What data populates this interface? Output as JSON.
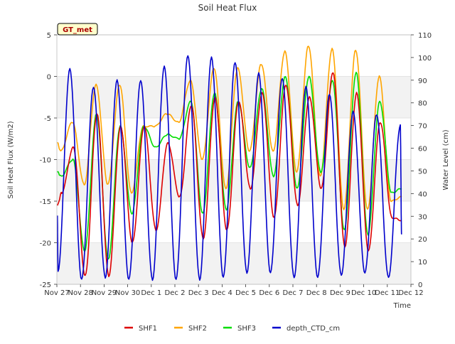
{
  "chart_data": {
    "type": "line",
    "title": "Soil Heat Flux",
    "xlabel": "Time",
    "ylabel": "Soil Heat Flux (W/m2)",
    "y2label": "Water Level (cm)",
    "site_badge": "GT_met",
    "x_ticks": [
      "Nov 27",
      "Nov 28",
      "Nov 29",
      "Nov 30",
      "Dec 1",
      "Dec 2",
      "Dec 3",
      "Dec 4",
      "Dec 5",
      "Dec 6",
      "Dec 7",
      "Dec 8",
      "Dec 9",
      "Dec 10",
      "Dec 11",
      "Dec 12"
    ],
    "x_start": "2023-11-27",
    "xlim_days": [
      0,
      15
    ],
    "ylim": [
      -25,
      5
    ],
    "y_ticks": [
      -25,
      -20,
      -15,
      -10,
      -5,
      0,
      5
    ],
    "y2lim": [
      0,
      110
    ],
    "y2_ticks": [
      0,
      10,
      20,
      30,
      40,
      50,
      60,
      70,
      80,
      90,
      100,
      110
    ],
    "grid": true,
    "legend_position": "bottom",
    "colors": {
      "SHF1": "#dd0000",
      "SHF2": "#ffa500",
      "SHF3": "#00dd00",
      "depth_CTD_cm": "#0000cc"
    },
    "series": [
      {
        "name": "SHF1",
        "axis": "left",
        "mins": [
          -14.0,
          -24.0,
          -24.0,
          -20.0,
          -18.5,
          -14.5,
          -19.5,
          -18.5,
          -13.5,
          -17.0,
          -15.5,
          -13.5,
          -20.5,
          -21.0,
          -17.0
        ],
        "maxs": [
          -8.5,
          -4.5,
          -6.0,
          -6.0,
          -8.0,
          -3.5,
          -2.5,
          -3.0,
          -2.0,
          -1.0,
          -2.5,
          0.5,
          -2.0,
          -5.5,
          -6.0
        ],
        "start": -15.5,
        "end": -17.3
      },
      {
        "name": "SHF2",
        "axis": "left",
        "mins": [
          -9.0,
          -13.0,
          -13.0,
          -14.0,
          -6.0,
          -5.5,
          -10.0,
          -13.5,
          -9.0,
          -9.0,
          -11.5,
          -12.0,
          -16.0,
          -16.0,
          -15.0
        ],
        "maxs": [
          -5.5,
          -1.0,
          -1.0,
          -6.0,
          -4.5,
          -0.5,
          1.0,
          1.0,
          1.5,
          3.0,
          3.7,
          3.3,
          3.2,
          0.0,
          0.0
        ],
        "start": -8.0,
        "end": -14.5
      },
      {
        "name": "SHF3",
        "axis": "left",
        "mins": [
          -12.0,
          -21.0,
          -22.0,
          -16.5,
          -8.5,
          -7.5,
          -16.5,
          -16.0,
          -11.0,
          -12.0,
          -13.5,
          -11.5,
          -18.5,
          -19.0,
          -14.0
        ],
        "maxs": [
          -10.0,
          -4.5,
          -6.0,
          -6.0,
          -7.0,
          -3.0,
          -2.0,
          -3.0,
          -1.5,
          0.0,
          0.0,
          -0.5,
          0.5,
          -3.0,
          -4.0
        ],
        "start": -11.5,
        "end": -13.5
      },
      {
        "name": "depth_CTD_cm",
        "axis": "right",
        "mins": [
          6.0,
          2.0,
          3.0,
          2.0,
          2.0,
          2.0,
          2.0,
          3.0,
          5.0,
          5.0,
          3.0,
          3.0,
          4.0,
          5.0,
          3.0
        ],
        "maxs": [
          95.0,
          87.0,
          90.0,
          90.0,
          96.0,
          101.0,
          100.0,
          98.0,
          93.0,
          91.0,
          87.0,
          84.0,
          76.0,
          75.0,
          70.0
        ],
        "start": 30.0,
        "end": 22.0
      }
    ]
  }
}
